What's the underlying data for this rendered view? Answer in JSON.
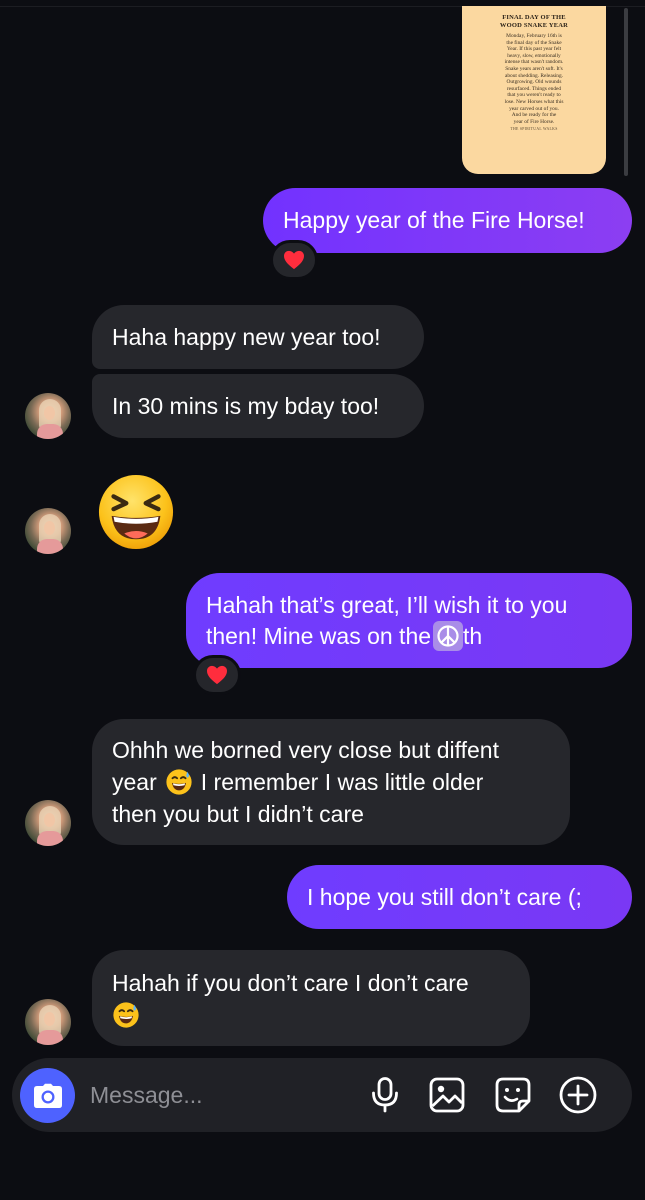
{
  "shared_post": {
    "title_lines": [
      "FINAL DAY OF THE",
      "WOOD SNAKE YEAR"
    ],
    "body_lines": [
      "Monday, February 16th is",
      "the final day of the Snake",
      "Year. If this past year felt",
      "heavy, slow, emotionally",
      "intense that wasn't random.",
      "Snake years aren't soft. It's",
      "about shedding. Releasing.",
      "Outgrowing. Old wounds",
      "resurfaced. Things ended",
      "that you weren't ready to",
      "lose. New Horses what this",
      "year carved out of you.",
      "And be ready for the",
      "year of Fire Horse."
    ],
    "signature": "THE SPIRITUAL WALKS"
  },
  "messages": [
    {
      "from": "me",
      "text": "Happy year of the Fire Horse!",
      "reaction": "❤️"
    },
    {
      "from": "them",
      "text": "Haha happy new year too!"
    },
    {
      "from": "them",
      "text": "In 30 mins is my bday too!"
    },
    {
      "from": "them",
      "emoji": "😆"
    },
    {
      "from": "me",
      "text_lines": [
        "Hahah that’s great, I’ll wish it to you",
        "then! Mine was on the"
      ],
      "inline_emoji": "☮️",
      "text_tail": "th",
      "reaction": "❤️"
    },
    {
      "from": "them",
      "text_lines_start": "Ohhh we borned very close but diffent",
      "line2_prefix": "year",
      "line2_emoji": "😅",
      "line2_rest": "I remember I was little older",
      "line3": "then you but I didn’t care"
    },
    {
      "from": "me",
      "text": "I hope you still don’t care (;"
    },
    {
      "from": "them",
      "text": "Hahah if you don’t care I don’t care",
      "trailing_emoji": "😅"
    }
  ],
  "composer": {
    "placeholder": "Message..."
  },
  "icons": {
    "camera": "camera-icon",
    "mic": "microphone-icon",
    "gallery": "image-icon",
    "sticker": "sticker-icon",
    "more": "plus-circle-icon"
  },
  "colors": {
    "background": "#0c0d12",
    "sent_bubble": "#7a38f4",
    "received_bubble": "#26272c",
    "camera_button": "#4e62ff",
    "heart": "#ff2d3d"
  }
}
